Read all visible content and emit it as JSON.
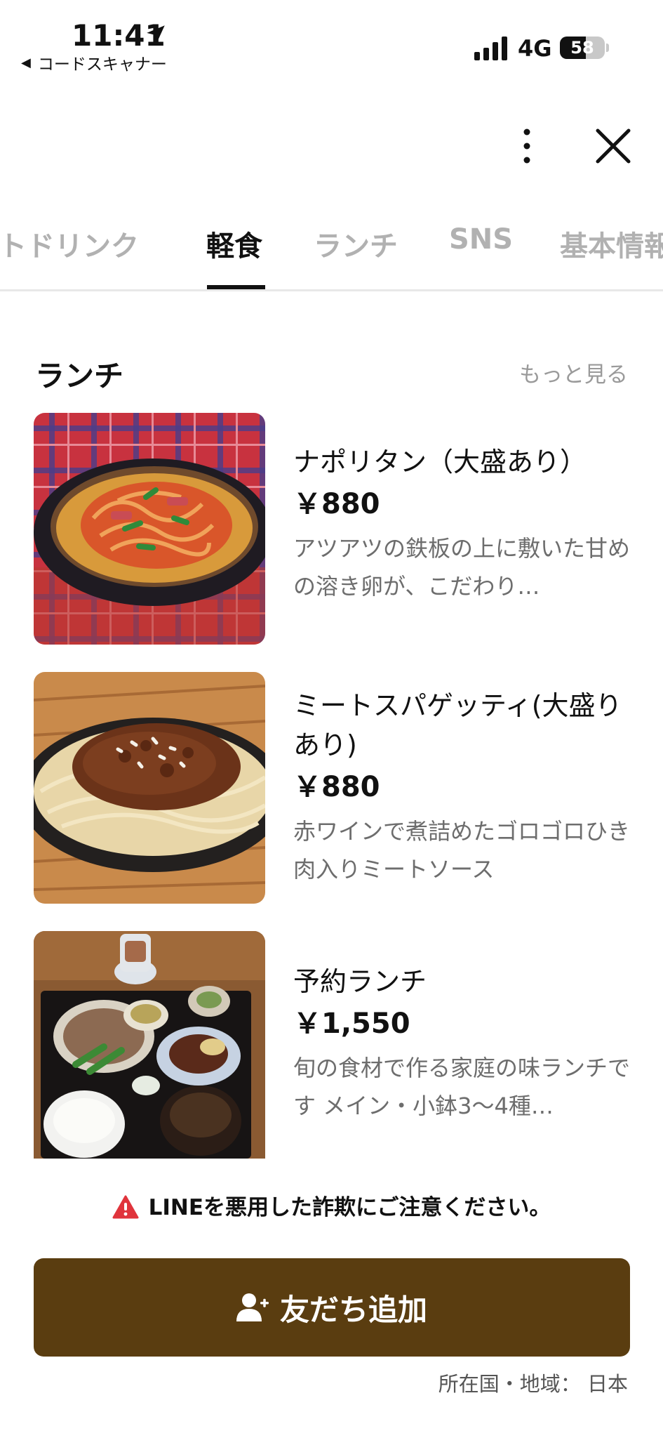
{
  "status_bar": {
    "time": "11:41",
    "back_app": "コードスキャナー",
    "network": "4G",
    "battery_percent": "58",
    "battery_level": 0.58
  },
  "tabs": [
    {
      "label": "ソフトドリンク",
      "active": false
    },
    {
      "label": "軽食",
      "active": true
    },
    {
      "label": "ランチ",
      "active": false
    },
    {
      "label": "SNS",
      "active": false
    },
    {
      "label": "基本情報",
      "active": false
    }
  ],
  "section": {
    "title": "ランチ",
    "see_more": "もっと見る"
  },
  "items": [
    {
      "name": "ナポリタン（大盛あり）",
      "price": "￥880",
      "description": "アツアツの鉄板の上に敷いた甘めの溶き卵が、こだわり…"
    },
    {
      "name": "ミートスパゲッティ(大盛りあり)",
      "price": "￥880",
      "description": "赤ワインで煮詰めたゴロゴロひき肉入りミートソース"
    },
    {
      "name": "予約ランチ",
      "price": "￥1,550",
      "description": "旬の食材で作る家庭の味ランチです メイン・小鉢3〜4種…"
    }
  ],
  "warning": "LINEを悪用した詐欺にご注意ください。",
  "add_friend_label": "友だち追加",
  "location": "所在国・地域：  日本",
  "colors": {
    "brand_button": "#5a3d10",
    "warning_red": "#e0343c",
    "inactive_tab": "#b1b1b1"
  },
  "icons": [
    "location-arrow-icon",
    "signal-icon",
    "more-vertical-icon",
    "close-icon",
    "warning-icon",
    "add-friend-icon"
  ]
}
